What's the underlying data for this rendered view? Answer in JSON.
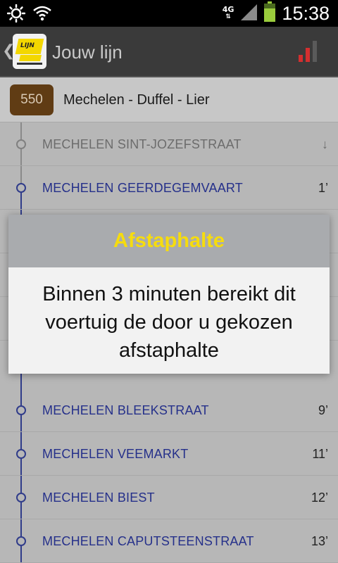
{
  "status_bar": {
    "network_type": "4G",
    "time": "15:38",
    "icons": [
      "brightness-icon",
      "wifi-icon",
      "cell-signal-icon",
      "battery-icon"
    ]
  },
  "action_bar": {
    "title": "Jouw lijn",
    "logo_text": "LIJN",
    "icons": [
      "back-chevron-icon",
      "delijn-logo-icon",
      "signal-strength-icon"
    ],
    "signal_color": "#d32f2f"
  },
  "route": {
    "number": "550",
    "name": "Mechelen - Duffel - Lier",
    "badge_color": "#603c14"
  },
  "stops": [
    {
      "name": "MECHELEN SINT-JOZEFSTRAAT",
      "time": "↓",
      "state": "passed"
    },
    {
      "name": "MECHELEN GEERDEGEMVAART",
      "time": "1’",
      "state": "upcoming"
    },
    {
      "name": "",
      "time": "",
      "state": "upcoming"
    },
    {
      "name": "",
      "time": "",
      "state": "upcoming"
    },
    {
      "name": "",
      "time": "",
      "state": "upcoming"
    },
    {
      "name": "MECHELEN BLEEKSTRAAT",
      "time": "9’",
      "state": "upcoming"
    },
    {
      "name": "MECHELEN VEEMARKT",
      "time": "11’",
      "state": "upcoming"
    },
    {
      "name": "MECHELEN BIEST",
      "time": "12’",
      "state": "upcoming"
    },
    {
      "name": "MECHELEN CAPUTSTEENSTRAAT",
      "time": "13’",
      "state": "upcoming"
    }
  ],
  "dialog": {
    "title": "Afstaphalte",
    "message": "Binnen 3 minuten bereikt dit voertuig de door u gekozen afstaphalte",
    "title_color": "#f6dc0e"
  }
}
